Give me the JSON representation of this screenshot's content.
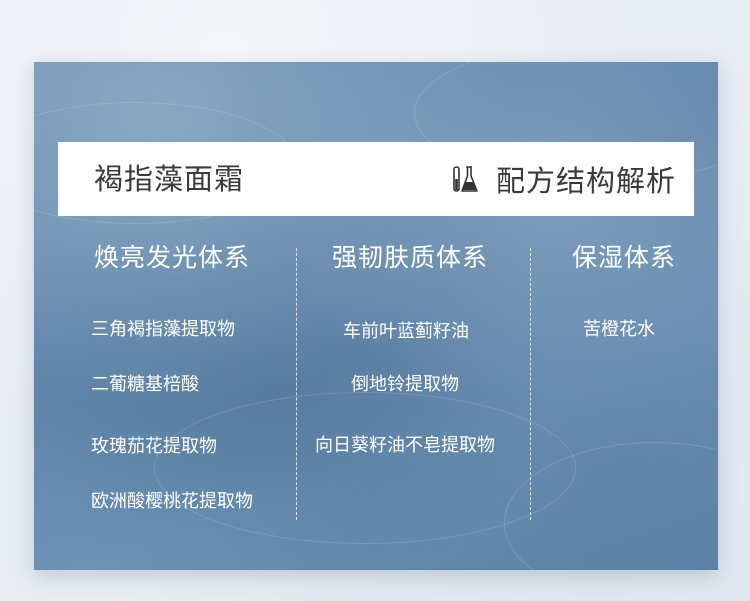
{
  "product": {
    "name": "褐指藻面霜"
  },
  "header": {
    "title": "配方结构解析",
    "icon": "flask-icon"
  },
  "columns": [
    {
      "title": "焕亮发光体系",
      "items": [
        "三角褐指藻提取物",
        "二葡糖基棓酸",
        "玫瑰茄花提取物",
        "欧洲酸樱桃花提取物"
      ]
    },
    {
      "title": "强韧肤质体系",
      "items": [
        "车前叶蓝蓟籽油",
        "倒地铃提取物",
        "向日葵籽油不皂提取物"
      ]
    },
    {
      "title": "保湿体系",
      "items": [
        "苦橙花水"
      ]
    }
  ]
}
